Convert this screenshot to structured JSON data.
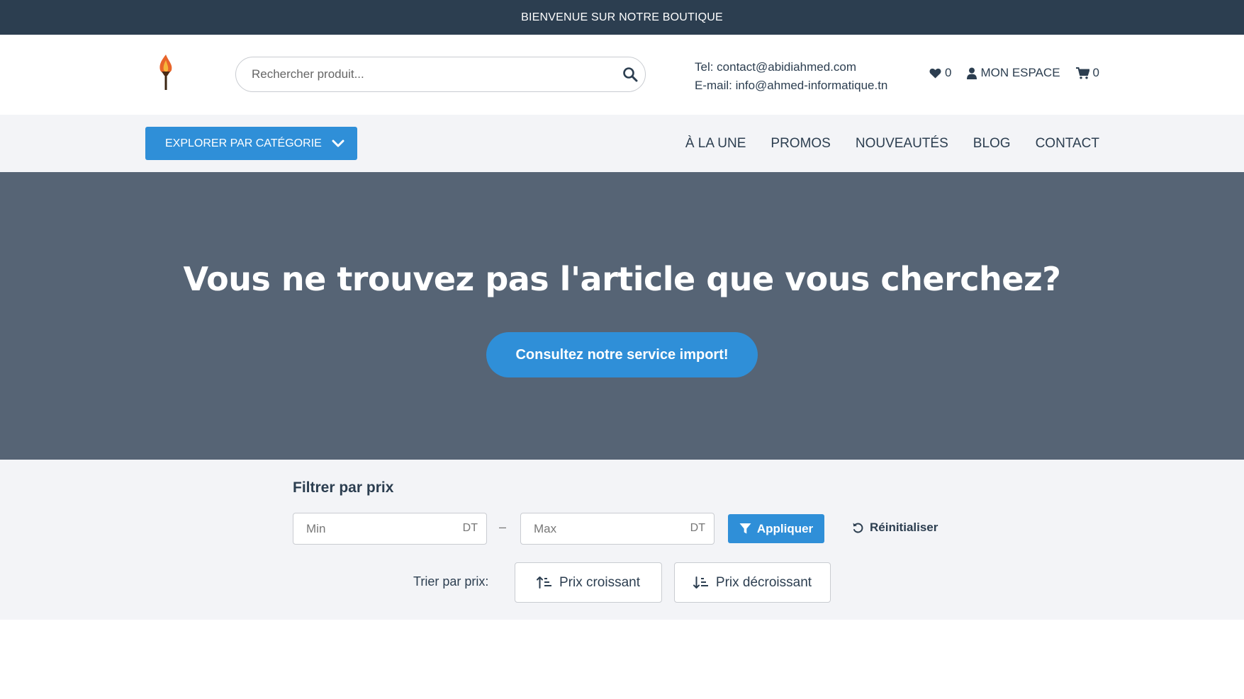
{
  "topbar": {
    "text": "BIENVENUE SUR NOTRE BOUTIQUE"
  },
  "header": {
    "logo_icon": "torch-logo",
    "search": {
      "placeholder": "Rechercher produit...",
      "value": ""
    },
    "contact": {
      "tel": "Tel: contact@abidiahmed.com",
      "email": "E-mail: info@ahmed-informatique.tn"
    },
    "wishlist_count": "0",
    "account_label": "MON ESPACE",
    "cart_count": "0"
  },
  "nav": {
    "explore_label": "EXPLORER PAR CATÉGORIE",
    "links": [
      "À LA UNE",
      "PROMOS",
      "NOUVEAUTÉS",
      "BLOG",
      "CONTACT"
    ]
  },
  "hero": {
    "title": "Vous ne trouvez pas l'article que vous cherchez?",
    "button_label": "Consultez notre service import!"
  },
  "filter": {
    "title": "Filtrer par prix",
    "min_placeholder": "Min",
    "max_placeholder": "Max",
    "unit": "DT",
    "separator": "–",
    "apply_label": "Appliquer",
    "reset_label": "Réinitialiser",
    "sort_label": "Trier par prix:",
    "sort_asc_label": "Prix croissant",
    "sort_desc_label": "Prix décroissant"
  },
  "colors": {
    "topbar": "#2c3e50",
    "accent": "#2f8fd8",
    "hero_bg": "#566475",
    "nav_bg": "#f3f4f7"
  }
}
